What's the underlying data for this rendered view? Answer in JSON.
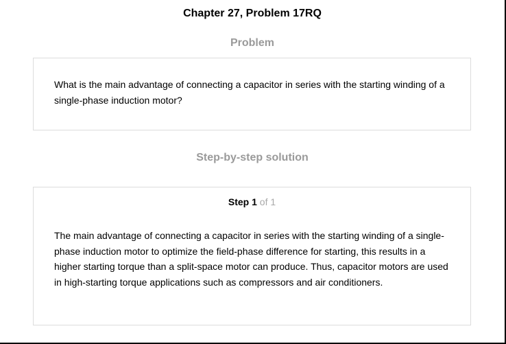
{
  "header": {
    "title": "Chapter 27, Problem 17RQ"
  },
  "problem": {
    "heading": "Problem",
    "text": "What is the main advantage of connecting a capacitor in series with the starting winding of a single-phase induction motor?"
  },
  "solution": {
    "heading": "Step-by-step solution",
    "step": {
      "word": "Step",
      "number": "1",
      "of_text": "of 1"
    },
    "text": "The main advantage of connecting a capacitor in series with the starting winding of a single-phase induction motor to optimize the field-phase difference for starting, this results in a higher starting torque than a split-space motor can produce. Thus, capacitor motors are used in high-starting torque applications such as compressors and air conditioners."
  }
}
